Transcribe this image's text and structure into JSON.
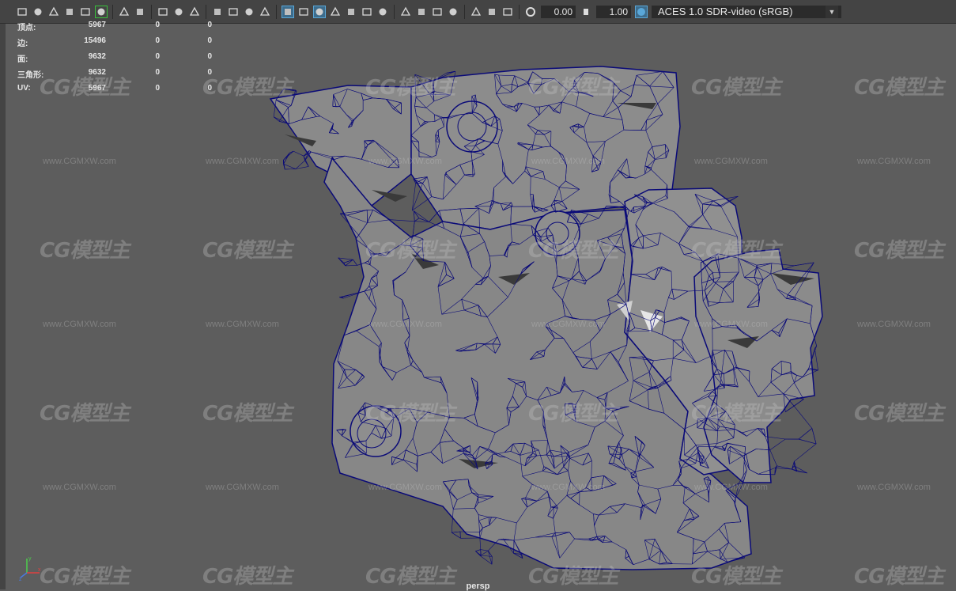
{
  "toolbar": {
    "icons": [
      "camera-icon",
      "camera-attributes-icon",
      "image-plane-icon",
      "bookmark-icon",
      "select-camera-icon",
      "grease-pencil-icon",
      "2d-pan-icon",
      "grid-icon",
      "film-gate-icon",
      "resolution-gate-icon",
      "gate-mask-icon",
      "field-chart-icon",
      "safe-action-icon",
      "safe-title-icon",
      "wireframe-icon",
      "smooth-shade-icon",
      "default-material-icon",
      "wireframe-on-shaded-icon",
      "xray-icon",
      "use-all-lights-icon",
      "shadows-icon",
      "screen-space-ao-icon",
      "motion-blur-icon",
      "multisample-aa-icon",
      "depth-of-field-icon",
      "isolate-select-icon",
      "xray-joints-icon",
      "xray-active-icon",
      "backface-icon",
      "exposure-icon",
      "gamma-icon",
      "color-management-icon"
    ],
    "exposure_value": "0.00",
    "gamma_value": "1.00",
    "color_space": "ACES 1.0 SDR-video (sRGB)"
  },
  "hud": {
    "rows": [
      {
        "label": "顶点:",
        "v1": "5967",
        "v2": "0",
        "v3": "0"
      },
      {
        "label": "边:",
        "v1": "15496",
        "v2": "0",
        "v3": "0"
      },
      {
        "label": "面:",
        "v1": "9632",
        "v2": "0",
        "v3": "0"
      },
      {
        "label": "三角形:",
        "v1": "9632",
        "v2": "0",
        "v3": "0"
      },
      {
        "label": "UV:",
        "v1": "5967",
        "v2": "0",
        "v3": "0"
      }
    ]
  },
  "viewport": {
    "camera_label": "persp",
    "axis_labels": {
      "x": "x",
      "y": "y",
      "z": "z"
    }
  },
  "watermark": {
    "logo": "CG模型主",
    "url": "www.CGMXW.com"
  },
  "colors": {
    "background": "#5d5d5d",
    "mesh_fill": "#888888",
    "wire": "#0a0a78",
    "toolbar": "#444444",
    "accent": "#5aa7d8"
  }
}
